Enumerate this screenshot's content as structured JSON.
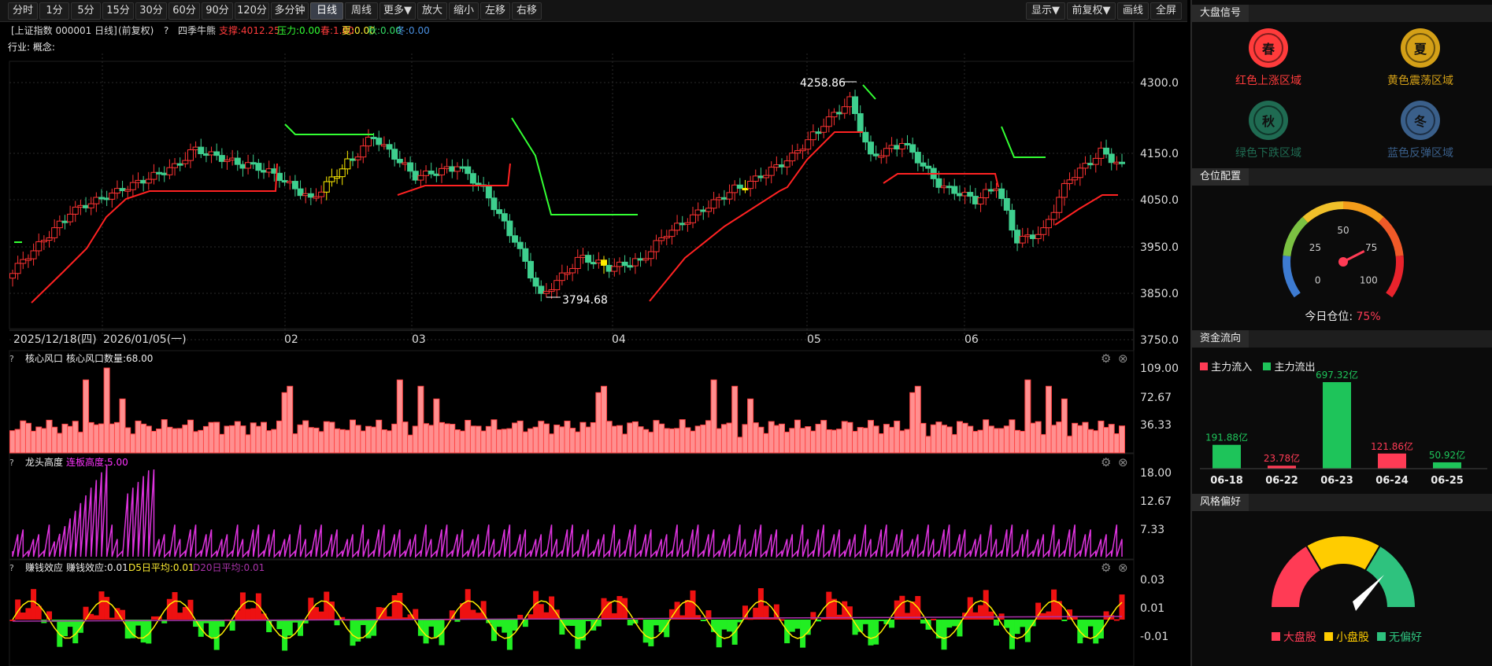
{
  "toolbar": {
    "left": [
      "分时",
      "1分",
      "5分",
      "15分",
      "30分",
      "60分",
      "90分",
      "120分",
      "多分钟",
      "日线",
      "周线",
      "更多▼",
      "放大",
      "缩小",
      "左移",
      "右移"
    ],
    "right": [
      "显示▼",
      "前复权▼",
      "画线",
      "全屏"
    ],
    "active": "日线"
  },
  "chart_header": {
    "symbol": "[上证指数 000001 日线]",
    "adjust": "(前复权)",
    "help": "?",
    "indicator": "四季牛熊",
    "support": "支撑:4012.25",
    "resistance": "压力:0.00",
    "spring": "春:1.00",
    "summer": "夏:0.00",
    "autumn": "秋:0.00",
    "winter": "冬:0.00",
    "industry": "行业: 概念:"
  },
  "price_axis": [
    "4300.0",
    "4150.0",
    "4050.0",
    "3950.0",
    "3850.0",
    "3750.0"
  ],
  "annotations": {
    "high": "4258.86",
    "low": "3794.68"
  },
  "date_axis": [
    "2025/12/18(四)",
    "2026/01/05(一)",
    "02",
    "03",
    "04",
    "05",
    "06"
  ],
  "panel1": {
    "help": "?",
    "title": "核心风口",
    "label": "核心风口数量:68.00",
    "axis": [
      "109.00",
      "72.67",
      "36.33"
    ]
  },
  "panel2": {
    "help": "?",
    "title": "龙头高度",
    "label": "连板高度:5.00",
    "axis": [
      "18.00",
      "12.67",
      "7.33"
    ]
  },
  "panel3": {
    "help": "?",
    "title": "赚钱效应",
    "label": "赚钱效应:0.01",
    "d5": "D5日平均:0.01",
    "d20": "D20日平均:0.01",
    "axis": [
      "0.03",
      "0.01",
      "-0.01"
    ]
  },
  "right_panel": {
    "signal_title": "大盘信号",
    "signals": [
      {
        "char": "春",
        "label": "红色上涨区域",
        "color": "#ff3b3b",
        "icon": "spring-icon"
      },
      {
        "char": "夏",
        "label": "黄色震荡区域",
        "color": "#d4a017",
        "icon": "summer-icon"
      },
      {
        "char": "秋",
        "label": "绿色下跌区域",
        "color": "#1f6b52",
        "icon": "autumn-icon"
      },
      {
        "char": "冬",
        "label": "蓝色反弹区域",
        "color": "#3a5f8a",
        "icon": "winter-icon"
      }
    ],
    "position_title": "仓位配置",
    "gauge_ticks": [
      "0",
      "25",
      "50",
      "75",
      "100"
    ],
    "position_label": "今日仓位:",
    "position_value": "75%",
    "flow_title": "资金流向",
    "flow_legend_in": "主力流入",
    "flow_legend_out": "主力流出",
    "flow_colors": {
      "in": "#ff3b55",
      "out": "#1ec45a"
    },
    "style_title": "风格偏好",
    "style_legend": [
      "大盘股",
      "小盘股",
      "无偏好"
    ],
    "style_colors": [
      "#ff3b55",
      "#ffcc00",
      "#2ec27e"
    ]
  },
  "chart_data": [
    {
      "type": "bar",
      "title": "资金流向",
      "categories": [
        "06-18",
        "06-22",
        "06-23",
        "06-24",
        "06-25"
      ],
      "values": [
        191.88,
        23.78,
        697.32,
        121.86,
        50.92
      ],
      "value_labels": [
        "191.88亿",
        "23.78亿",
        "697.32亿",
        "121.86亿",
        "50.92亿"
      ],
      "direction": [
        "out",
        "in",
        "out",
        "in",
        "out"
      ]
    },
    {
      "type": "line",
      "title": "核心风口",
      "ylim": [
        0,
        109
      ],
      "last_value": 68.0
    }
  ]
}
